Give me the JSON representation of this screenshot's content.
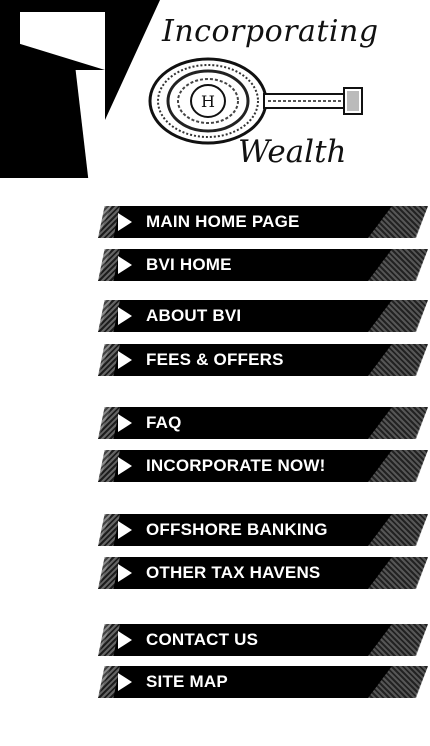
{
  "logo": {
    "line1": "Incorporating",
    "monogram": "H",
    "line2": "Wealth"
  },
  "nav": [
    {
      "label": "MAIN HOME PAGE"
    },
    {
      "label": "BVI HOME"
    },
    {
      "label": "ABOUT BVI"
    },
    {
      "label": "FEES & OFFERS"
    },
    {
      "label": "FAQ"
    },
    {
      "label": "INCORPORATE NOW!"
    },
    {
      "label": "OFFSHORE BANKING"
    },
    {
      "label": "OTHER TAX HAVENS"
    },
    {
      "label": "CONTACT US"
    },
    {
      "label": "SITE MAP"
    }
  ],
  "colors": {
    "bar": "#000000",
    "text": "#ffffff",
    "background": "#ffffff"
  }
}
